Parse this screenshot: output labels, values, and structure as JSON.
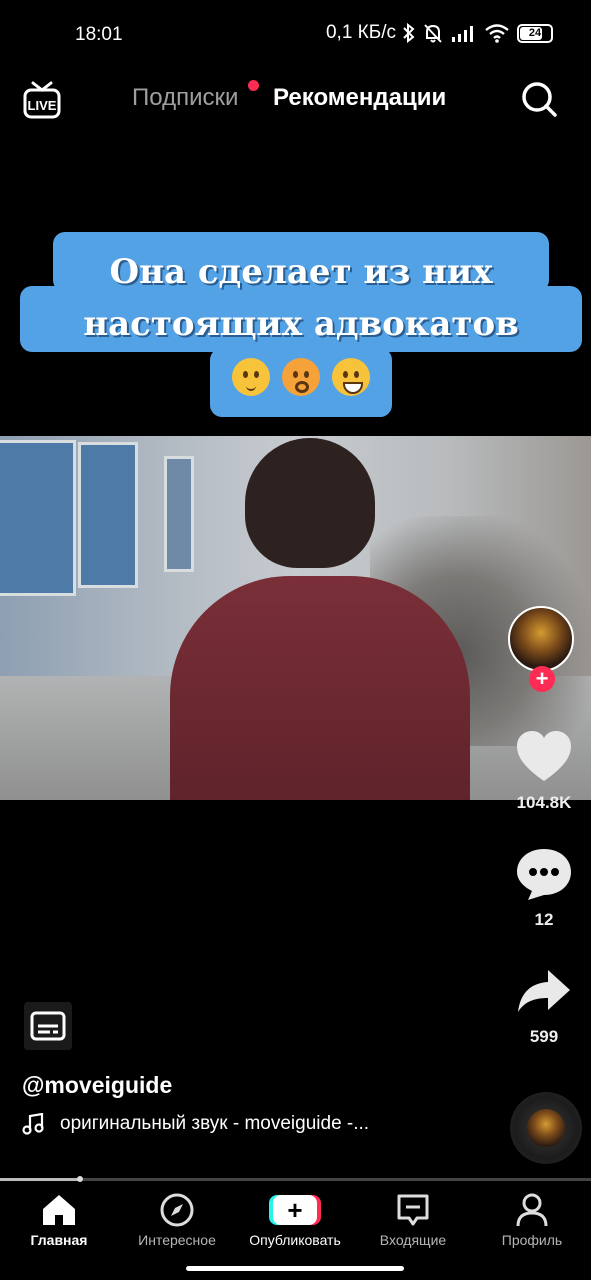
{
  "status_bar": {
    "time": "18:01",
    "network_speed": "0,1 КБ/с",
    "battery": "24",
    "icons": [
      "bluetooth-icon",
      "muted-bell-icon",
      "signal-icon",
      "wifi-icon",
      "battery-icon"
    ]
  },
  "top_nav": {
    "live_label": "LIVE",
    "tab_following": "Подписки",
    "tab_for_you": "Рекомендации",
    "notification_dot_color": "#fe2c55",
    "search_icon": "search-icon"
  },
  "video": {
    "caption_line1": "Она сделает из них",
    "caption_line2": "настоящих адвокатов",
    "caption_emojis": [
      "thinking-face",
      "exploding-head",
      "grinning-face"
    ],
    "caption_bg_color": "#54a2e6"
  },
  "actions": {
    "likes": "104.8K",
    "comments": "12",
    "shares": "599"
  },
  "post": {
    "username": "@moveiguide",
    "sound": "оригинальный звук - moveiguide -..."
  },
  "playback": {
    "progress": 0.135
  },
  "bottom_nav": {
    "home": "Главная",
    "discover": "Интересное",
    "publish": "Опубликовать",
    "inbox": "Входящие",
    "profile": "Профиль"
  },
  "colors": {
    "accent_red": "#fe2c55",
    "accent_cyan": "#25f4ee",
    "background": "#000000"
  }
}
